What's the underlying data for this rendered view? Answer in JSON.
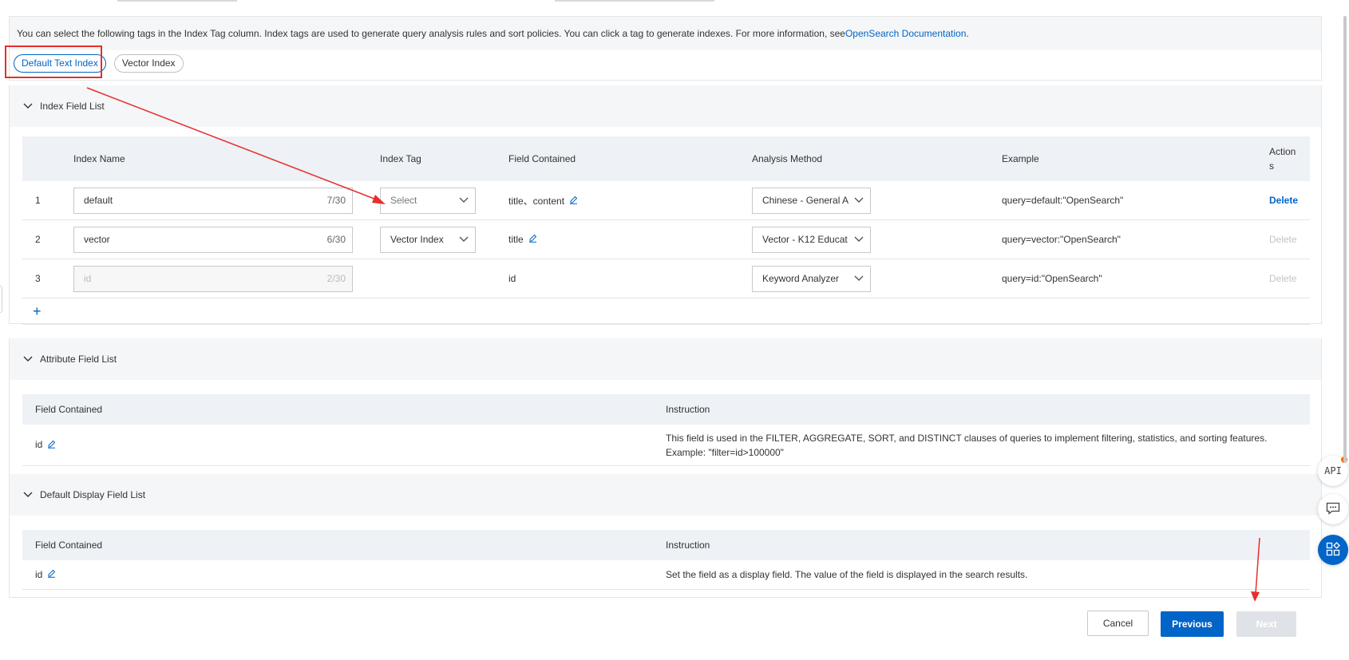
{
  "info": {
    "text": "You can select the following tags in the Index Tag column. Index tags are used to generate query analysis rules and sort policies. You can click a tag to generate indexes. For more information, see",
    "link_label": "OpenSearch Documentation",
    "suffix": "."
  },
  "tags": [
    "Default Text Index",
    "Vector Index"
  ],
  "index_section": {
    "title": "Index Field List",
    "columns": [
      "Index Name",
      "Index Tag",
      "Field Contained",
      "Analysis Method",
      "Example",
      "Action\ns"
    ],
    "rows": [
      {
        "no": "1",
        "name": "default",
        "count": "7/30",
        "tag": "Select",
        "field": "title、content",
        "method": "Chinese - General A",
        "example": "query=default:\"OpenSearch\"",
        "action": "Delete"
      },
      {
        "no": "2",
        "name": "vector",
        "count": "6/30",
        "tag": "Vector Index",
        "field": "title",
        "method": "Vector - K12 Educat",
        "example": "query=vector:\"OpenSearch\"",
        "action": "Delete"
      },
      {
        "no": "3",
        "name": "id",
        "count": "2/30",
        "tag": "",
        "field": "id",
        "method": "Keyword Analyzer",
        "example": "query=id:\"OpenSearch\"",
        "action": "Delete"
      }
    ],
    "add_label": "+"
  },
  "attribute_section": {
    "title": "Attribute Field List",
    "columns": [
      "Field Contained",
      "Instruction"
    ],
    "rows": [
      {
        "field": "id",
        "instruction": "This field is used in the FILTER, AGGREGATE, SORT, and DISTINCT clauses of queries to implement filtering, statistics, and sorting features. Example: \"filter=id>100000\""
      }
    ]
  },
  "display_section": {
    "title": "Default Display Field List",
    "columns": [
      "Field Contained",
      "Instruction"
    ],
    "rows": [
      {
        "field": "id",
        "instruction": "Set the field as a display field. The value of the field is displayed in the search results."
      }
    ]
  },
  "footer": {
    "cancel": "Cancel",
    "previous": "Previous",
    "next": "Next"
  },
  "float": {
    "api_label": "API"
  },
  "colors": {
    "primary": "#0064c8",
    "annotation": "#e62e2e",
    "header_bg": "#f5f6f7",
    "table_head_bg": "#eef1f5"
  }
}
